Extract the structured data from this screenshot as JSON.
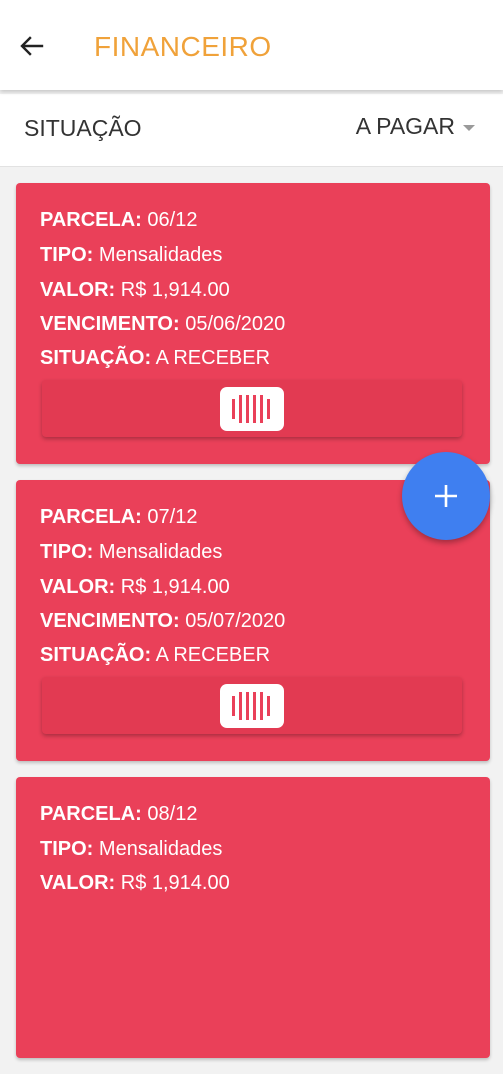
{
  "header": {
    "title": "FINANCEIRO"
  },
  "filter": {
    "label": "SITUAÇÃO",
    "value": "A PAGAR"
  },
  "labels": {
    "parcela": "PARCELA:",
    "tipo": "TIPO:",
    "valor": "VALOR:",
    "vencimento": "VENCIMENTO:",
    "situacao": "SITUAÇÃO:"
  },
  "cards": [
    {
      "parcela": "06/12",
      "tipo": "Mensalidades",
      "valor": "R$ 1,914.00",
      "vencimento": "05/06/2020",
      "situacao": "A RECEBER"
    },
    {
      "parcela": "07/12",
      "tipo": "Mensalidades",
      "valor": "R$ 1,914.00",
      "vencimento": "05/07/2020",
      "situacao": "A RECEBER"
    },
    {
      "parcela": "08/12",
      "tipo": "Mensalidades",
      "valor": "R$ 1,914.00"
    }
  ],
  "icons": {
    "back": "arrow-back-icon",
    "barcode": "barcode-icon",
    "add": "add-icon"
  },
  "colors": {
    "card": "#ea4059",
    "title": "#f0a23a",
    "fab": "#3f7ff0"
  }
}
